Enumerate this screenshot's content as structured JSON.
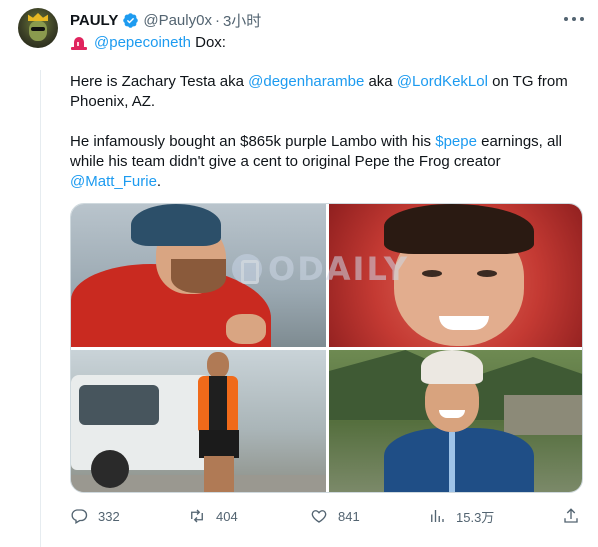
{
  "author": {
    "name": "PAULY",
    "handle": "@Pauly0x",
    "separator": "·",
    "time": "3小时"
  },
  "lead": {
    "mention": "@pepecoineth",
    "text": " Dox:"
  },
  "para1": {
    "t1": "Here is Zachary Testa aka ",
    "m1": "@degenharambe",
    "t2": " aka ",
    "m2": "@LordKekLol",
    "t3": " on TG from Phoenix, AZ."
  },
  "para2": {
    "t1": "He infamously bought an $865k purple Lambo with his ",
    "m1": "$pepe",
    "t2": " earnings, all while his team didn't give a cent to original Pepe the Frog creator ",
    "m2": "@Matt_Furie",
    "t3": "."
  },
  "watermark": "ODAILY",
  "actions": {
    "replies": "332",
    "retweets": "404",
    "likes": "841",
    "views": "15.3万"
  },
  "colors": {
    "accent": "#1d9bf0",
    "muted": "#536471",
    "text": "#0f1419",
    "alert": "#e0245e"
  },
  "icons": [
    "verified-badge-icon",
    "siren-icon",
    "more-icon",
    "reply-icon",
    "retweet-icon",
    "like-icon",
    "views-icon",
    "share-icon"
  ]
}
